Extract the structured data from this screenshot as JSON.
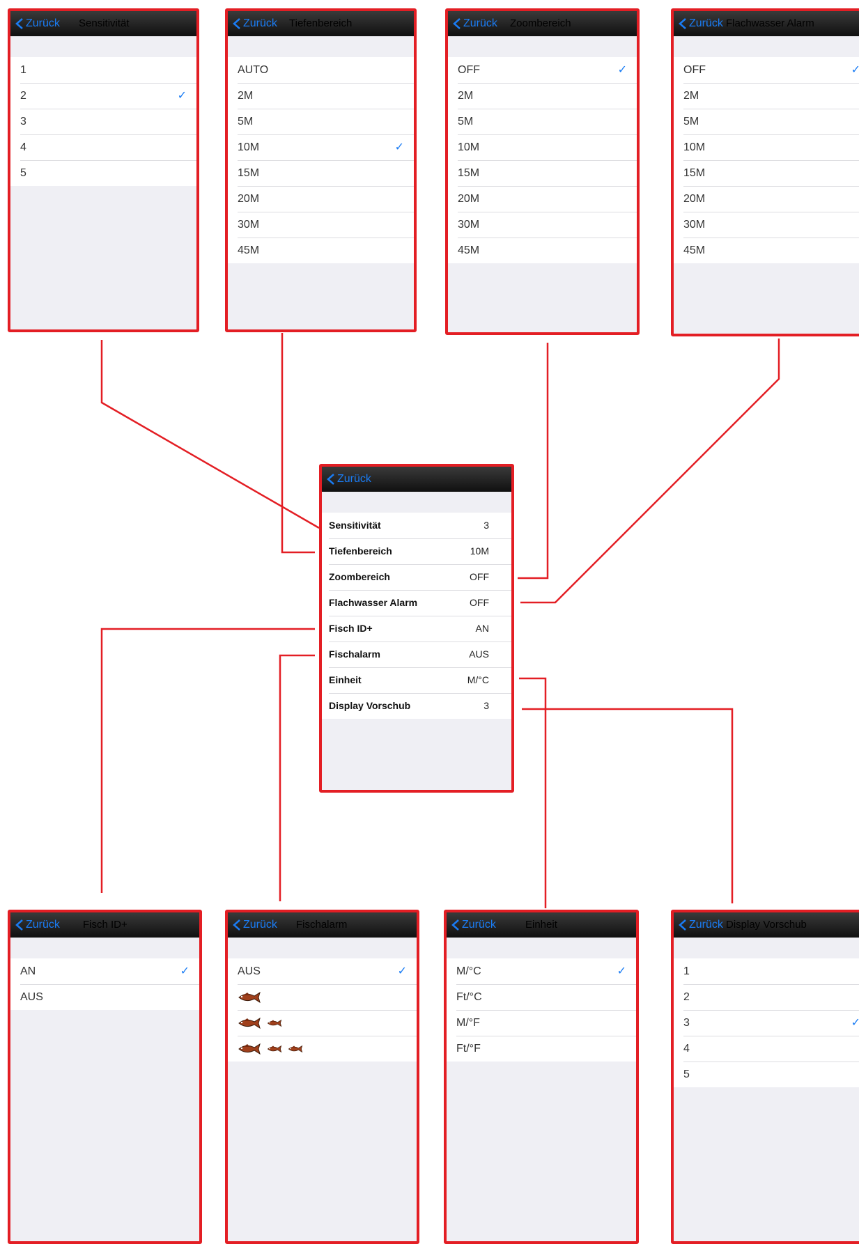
{
  "back_label": "Zurück",
  "colors": {
    "accent": "#1a7cf4",
    "frame": "#e31e24",
    "navbar": "#1a1a1a",
    "background": "#efeff4"
  },
  "main_menu": {
    "items": [
      {
        "label": "Sensitivität",
        "value": "3"
      },
      {
        "label": "Tiefenbereich",
        "value": "10M"
      },
      {
        "label": "Zoombereich",
        "value": "OFF"
      },
      {
        "label": "Flachwasser Alarm",
        "value": "OFF"
      },
      {
        "label": "Fisch ID+",
        "value": "AN"
      },
      {
        "label": "Fischalarm",
        "value": "AUS"
      },
      {
        "label": "Einheit",
        "value": "M/°C"
      },
      {
        "label": "Display Vorschub",
        "value": "3"
      }
    ]
  },
  "screens": {
    "sensitivity": {
      "title": "Sensitivität",
      "options": [
        "1",
        "2",
        "3",
        "4",
        "5"
      ],
      "selected": "2"
    },
    "depth_range": {
      "title": "Tiefenbereich",
      "options": [
        "AUTO",
        "2M",
        "5M",
        "10M",
        "15M",
        "20M",
        "30M",
        "45M"
      ],
      "selected": "10M"
    },
    "zoom_range": {
      "title": "Zoombereich",
      "options": [
        "OFF",
        "2M",
        "5M",
        "10M",
        "15M",
        "20M",
        "30M",
        "45M"
      ],
      "selected": "OFF"
    },
    "shallow_alarm": {
      "title": "Flachwasser Alarm",
      "options": [
        "OFF",
        "2M",
        "5M",
        "10M",
        "15M",
        "20M",
        "30M",
        "45M"
      ],
      "selected": "OFF"
    },
    "fish_id": {
      "title": "Fisch ID+",
      "options": [
        "AN",
        "AUS"
      ],
      "selected": "AN"
    },
    "fish_alarm": {
      "title": "Fischalarm",
      "options": [
        "AUS"
      ],
      "fish_icon_counts": [
        1,
        2,
        3
      ],
      "selected": "AUS"
    },
    "unit": {
      "title": "Einheit",
      "options": [
        "M/°C",
        "Ft/°C",
        "M/°F",
        "Ft/°F"
      ],
      "selected": "M/°C"
    },
    "display_feed": {
      "title": "Display Vorschub",
      "options": [
        "1",
        "2",
        "3",
        "4",
        "5"
      ],
      "selected": "3"
    }
  },
  "check_glyph": "✓"
}
